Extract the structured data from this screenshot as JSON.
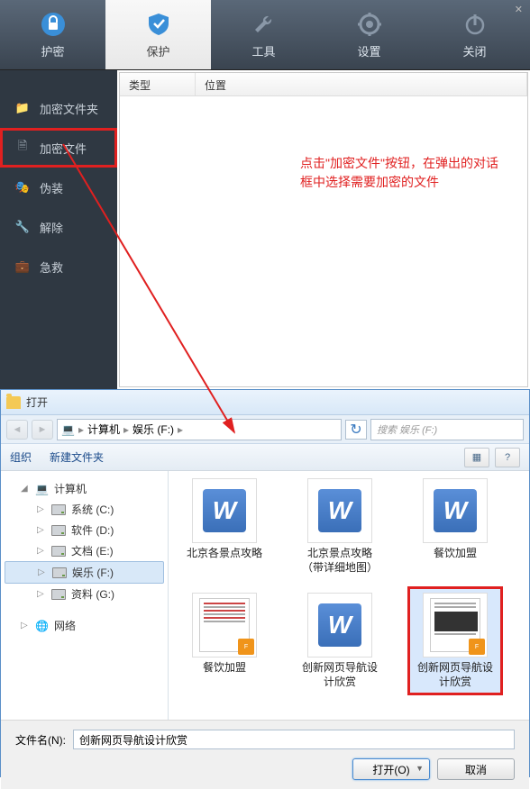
{
  "toolbar": {
    "items": [
      {
        "label": "护密",
        "icon": "lock-shield"
      },
      {
        "label": "保护",
        "icon": "shield"
      },
      {
        "label": "工具",
        "icon": "wrench"
      },
      {
        "label": "设置",
        "icon": "gear"
      },
      {
        "label": "关闭",
        "icon": "power"
      }
    ]
  },
  "sidebar": {
    "items": [
      {
        "label": "加密文件夹",
        "icon": "folder"
      },
      {
        "label": "加密文件",
        "icon": "file-lock"
      },
      {
        "label": "伪装",
        "icon": "mask"
      },
      {
        "label": "解除",
        "icon": "key"
      },
      {
        "label": "急救",
        "icon": "briefcase"
      }
    ]
  },
  "list": {
    "cols": [
      "类型",
      "位置"
    ]
  },
  "annotation": {
    "line1": "点击\"加密文件\"按钮，在弹出的对话",
    "line2": "框中选择需要加密的文件"
  },
  "dialog": {
    "title": "打开",
    "breadcrumb": [
      "计算机",
      "娱乐 (F:)"
    ],
    "search_placeholder": "搜索 娱乐 (F:)",
    "cmd": {
      "organize": "组织",
      "newfolder": "新建文件夹"
    },
    "tree": {
      "computer": "计算机",
      "drives": [
        {
          "label": "系统 (C:)"
        },
        {
          "label": "软件 (D:)"
        },
        {
          "label": "文档 (E:)"
        },
        {
          "label": "娱乐 (F:)"
        },
        {
          "label": "资料 (G:)"
        }
      ],
      "network": "网络"
    },
    "files": [
      {
        "label": "北京各景点攻略",
        "type": "word"
      },
      {
        "label": "北京景点攻略（带详细地图）",
        "type": "word"
      },
      {
        "label": "餐饮加盟",
        "type": "word"
      },
      {
        "label": "餐饮加盟",
        "type": "doc"
      },
      {
        "label": "创新网页导航设计欣赏",
        "type": "word"
      },
      {
        "label": "创新网页导航设计欣赏",
        "type": "doc-img"
      }
    ],
    "filename_label": "文件名(N):",
    "filename_value": "创新网页导航设计欣赏",
    "open_btn": "打开(O)",
    "cancel_btn": "取消"
  }
}
